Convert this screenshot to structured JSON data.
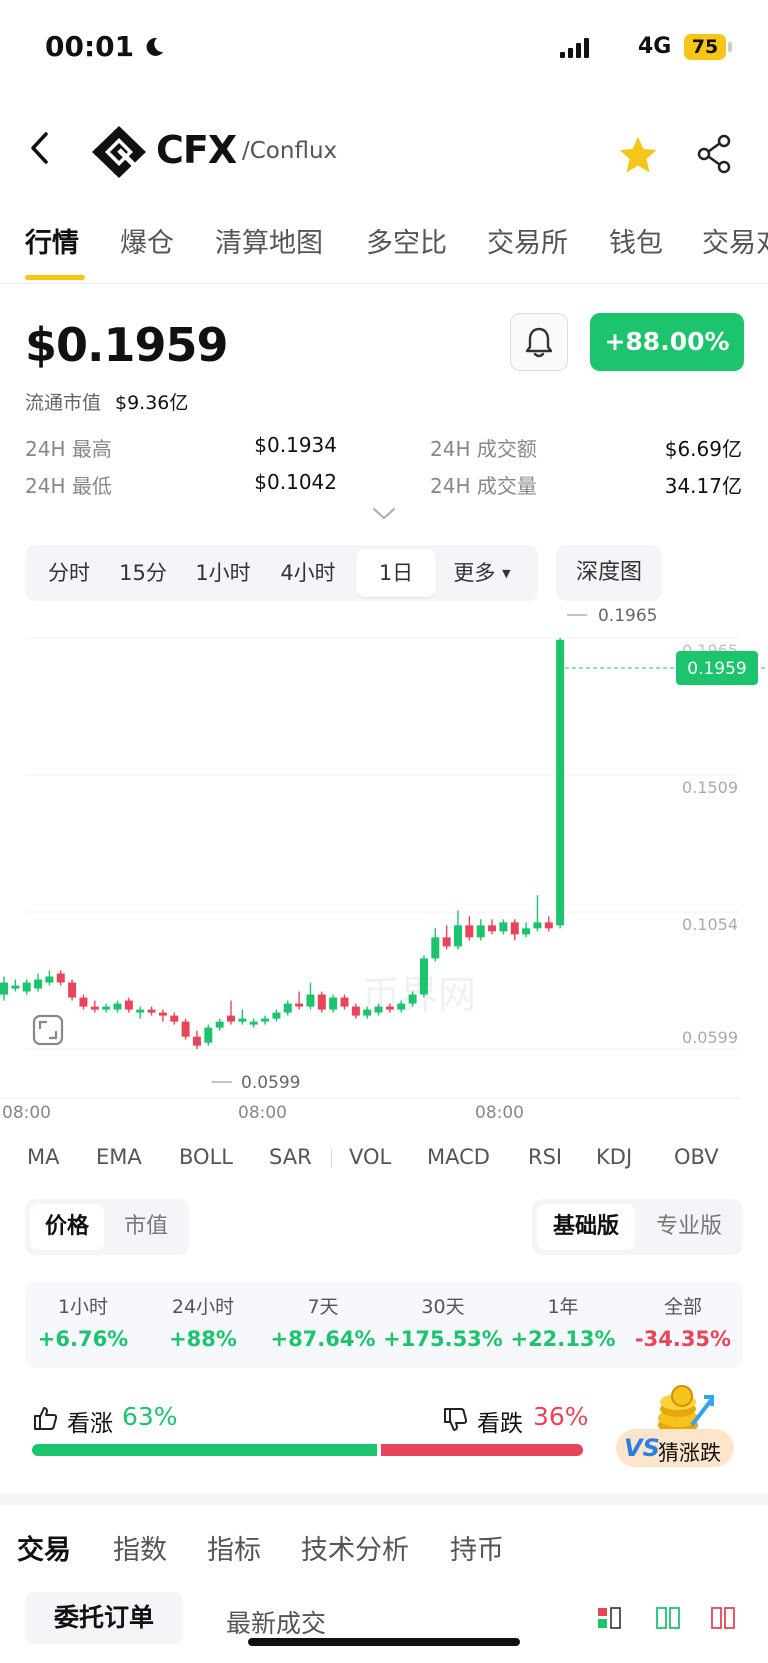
{
  "status_bar": {
    "time": "00:01",
    "network": "4G",
    "battery": "75"
  },
  "header": {
    "symbol": "CFX",
    "name": "/Conflux"
  },
  "tabs": [
    "行情",
    "爆仓",
    "清算地图",
    "多空比",
    "交易所",
    "钱包",
    "交易对"
  ],
  "price": {
    "value": "$0.1959",
    "mcap_label": "流通市值",
    "mcap_value": "$9.36亿",
    "change": "+88.00%",
    "high_label": "24H 最高",
    "high_value": "$0.1934",
    "low_label": "24H 最低",
    "low_value": "$0.1042",
    "turnover_label": "24H 成交额",
    "turnover_value": "$6.69亿",
    "volume_label": "24H 成交量",
    "volume_value": "34.17亿"
  },
  "intervals": [
    "分时",
    "15分",
    "1小时",
    "4小时",
    "1日",
    "更多"
  ],
  "depth_label": "深度图",
  "chart_data": {
    "type": "candlestick",
    "y_ticks": [
      "0.1965",
      "0.1509",
      "0.1054",
      "0.0599"
    ],
    "x_ticks": [
      "08:00",
      "08:00",
      "08:00"
    ],
    "high_label": "0.1965",
    "low_label": "0.0599",
    "current_label": "0.1959",
    "watermark": "币界网",
    "candles": [
      {
        "o": 0.078,
        "c": 0.082,
        "h": 0.084,
        "l": 0.076
      },
      {
        "o": 0.08,
        "c": 0.081,
        "h": 0.083,
        "l": 0.079
      },
      {
        "o": 0.079,
        "c": 0.082,
        "h": 0.083,
        "l": 0.078
      },
      {
        "o": 0.08,
        "c": 0.083,
        "h": 0.085,
        "l": 0.079
      },
      {
        "o": 0.082,
        "c": 0.084,
        "h": 0.086,
        "l": 0.081
      },
      {
        "o": 0.085,
        "c": 0.082,
        "h": 0.086,
        "l": 0.081
      },
      {
        "o": 0.082,
        "c": 0.077,
        "h": 0.083,
        "l": 0.076
      },
      {
        "o": 0.077,
        "c": 0.074,
        "h": 0.078,
        "l": 0.073
      },
      {
        "o": 0.074,
        "c": 0.073,
        "h": 0.076,
        "l": 0.072
      },
      {
        "o": 0.073,
        "c": 0.074,
        "h": 0.075,
        "l": 0.072
      },
      {
        "o": 0.073,
        "c": 0.075,
        "h": 0.076,
        "l": 0.072
      },
      {
        "o": 0.076,
        "c": 0.073,
        "h": 0.077,
        "l": 0.072
      },
      {
        "o": 0.072,
        "c": 0.073,
        "h": 0.074,
        "l": 0.07
      },
      {
        "o": 0.073,
        "c": 0.072,
        "h": 0.074,
        "l": 0.071
      },
      {
        "o": 0.072,
        "c": 0.071,
        "h": 0.073,
        "l": 0.069
      },
      {
        "o": 0.071,
        "c": 0.069,
        "h": 0.072,
        "l": 0.068
      },
      {
        "o": 0.069,
        "c": 0.064,
        "h": 0.07,
        "l": 0.063
      },
      {
        "o": 0.064,
        "c": 0.061,
        "h": 0.066,
        "l": 0.0599
      },
      {
        "o": 0.062,
        "c": 0.067,
        "h": 0.068,
        "l": 0.061
      },
      {
        "o": 0.067,
        "c": 0.069,
        "h": 0.07,
        "l": 0.066
      },
      {
        "o": 0.071,
        "c": 0.069,
        "h": 0.076,
        "l": 0.068
      },
      {
        "o": 0.069,
        "c": 0.07,
        "h": 0.073,
        "l": 0.068
      },
      {
        "o": 0.068,
        "c": 0.069,
        "h": 0.07,
        "l": 0.067
      },
      {
        "o": 0.069,
        "c": 0.07,
        "h": 0.071,
        "l": 0.068
      },
      {
        "o": 0.07,
        "c": 0.072,
        "h": 0.073,
        "l": 0.069
      },
      {
        "o": 0.072,
        "c": 0.075,
        "h": 0.076,
        "l": 0.071
      },
      {
        "o": 0.075,
        "c": 0.074,
        "h": 0.079,
        "l": 0.073
      },
      {
        "o": 0.074,
        "c": 0.078,
        "h": 0.082,
        "l": 0.073
      },
      {
        "o": 0.078,
        "c": 0.073,
        "h": 0.079,
        "l": 0.072
      },
      {
        "o": 0.073,
        "c": 0.077,
        "h": 0.078,
        "l": 0.072
      },
      {
        "o": 0.077,
        "c": 0.074,
        "h": 0.078,
        "l": 0.073
      },
      {
        "o": 0.074,
        "c": 0.071,
        "h": 0.075,
        "l": 0.07
      },
      {
        "o": 0.071,
        "c": 0.073,
        "h": 0.074,
        "l": 0.07
      },
      {
        "o": 0.072,
        "c": 0.074,
        "h": 0.075,
        "l": 0.071
      },
      {
        "o": 0.074,
        "c": 0.073,
        "h": 0.075,
        "l": 0.072
      },
      {
        "o": 0.073,
        "c": 0.075,
        "h": 0.076,
        "l": 0.072
      },
      {
        "o": 0.075,
        "c": 0.078,
        "h": 0.079,
        "l": 0.074
      },
      {
        "o": 0.078,
        "c": 0.09,
        "h": 0.091,
        "l": 0.077
      },
      {
        "o": 0.09,
        "c": 0.097,
        "h": 0.1,
        "l": 0.089
      },
      {
        "o": 0.097,
        "c": 0.094,
        "h": 0.101,
        "l": 0.093
      },
      {
        "o": 0.094,
        "c": 0.101,
        "h": 0.106,
        "l": 0.093
      },
      {
        "o": 0.101,
        "c": 0.097,
        "h": 0.104,
        "l": 0.096
      },
      {
        "o": 0.097,
        "c": 0.101,
        "h": 0.103,
        "l": 0.096
      },
      {
        "o": 0.101,
        "c": 0.099,
        "h": 0.103,
        "l": 0.098
      },
      {
        "o": 0.099,
        "c": 0.102,
        "h": 0.103,
        "l": 0.098
      },
      {
        "o": 0.102,
        "c": 0.098,
        "h": 0.103,
        "l": 0.096
      },
      {
        "o": 0.098,
        "c": 0.1,
        "h": 0.102,
        "l": 0.097
      },
      {
        "o": 0.1,
        "c": 0.102,
        "h": 0.111,
        "l": 0.099
      },
      {
        "o": 0.102,
        "c": 0.1,
        "h": 0.104,
        "l": 0.099
      },
      {
        "o": 0.101,
        "c": 0.1959,
        "h": 0.1965,
        "l": 0.1
      }
    ]
  },
  "indicators": [
    "MA",
    "EMA",
    "BOLL",
    "SAR",
    "VOL",
    "MACD",
    "RSI",
    "KDJ",
    "OBV"
  ],
  "view_toggle": {
    "price": "价格",
    "mcap": "市值",
    "basic": "基础版",
    "pro": "专业版"
  },
  "performance": [
    {
      "label": "1小时",
      "value": "+6.76%",
      "dir": "up"
    },
    {
      "label": "24小时",
      "value": "+88%",
      "dir": "up"
    },
    {
      "label": "7天",
      "value": "+87.64%",
      "dir": "up"
    },
    {
      "label": "30天",
      "value": "+175.53%",
      "dir": "up"
    },
    {
      "label": "1年",
      "value": "+22.13%",
      "dir": "up"
    },
    {
      "label": "全部",
      "value": "-34.35%",
      "dir": "down"
    }
  ],
  "sentiment": {
    "up_label": "看涨",
    "up_value": "63%",
    "down_label": "看跌",
    "down_value": "36%",
    "up_ratio": 0.63,
    "game_label": "猜涨跌",
    "game_vs": "VS"
  },
  "bottom_tabs": [
    "交易",
    "指数",
    "指标",
    "技术分析",
    "持币"
  ],
  "order_tabs": {
    "orders": "委托订单",
    "latest": "最新成交"
  }
}
